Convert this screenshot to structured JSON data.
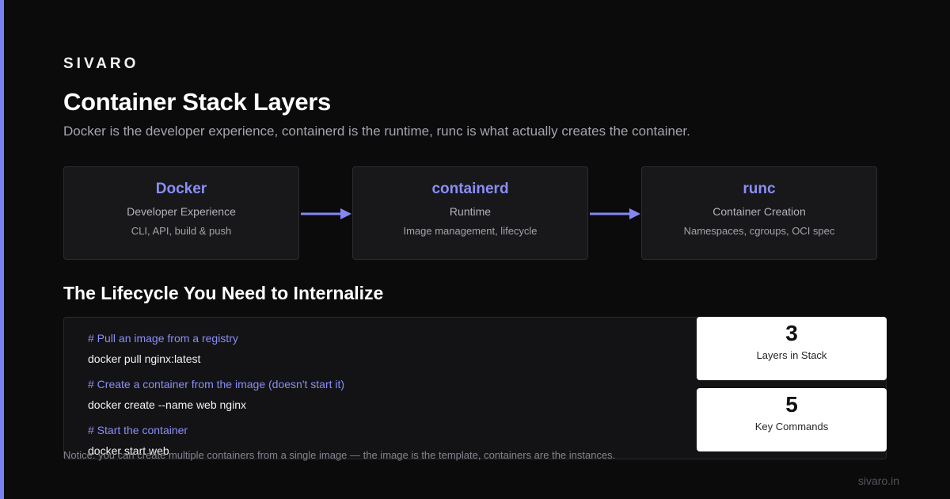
{
  "brand": "SIVARO",
  "title": "Container Stack Layers",
  "subtitle": "Docker is the developer experience, containerd is the runtime, runc is what actually creates the container.",
  "colors": {
    "accent": "#7c7ff0",
    "layer_name": "#8b8ef6",
    "background": "#0b0b0c"
  },
  "layers": [
    {
      "name": "Docker",
      "role": "Developer Experience",
      "detail": "CLI, API, build & push"
    },
    {
      "name": "containerd",
      "role": "Runtime",
      "detail": "Image management, lifecycle"
    },
    {
      "name": "runc",
      "role": "Container Creation",
      "detail": "Namespaces, cgroups, OCI spec"
    }
  ],
  "section_title": "The Lifecycle You Need to Internalize",
  "code": [
    {
      "comment": "# Pull an image from a registry",
      "command": "docker pull nginx:latest"
    },
    {
      "comment": "# Create a container from the image (doesn't start it)",
      "command": "docker create --name web nginx"
    },
    {
      "comment": "# Start the container",
      "command": "docker start web"
    }
  ],
  "stats": [
    {
      "value": "3",
      "label": "Layers in Stack"
    },
    {
      "value": "5",
      "label": "Key Commands"
    }
  ],
  "notice": "Notice: you can create multiple containers from a single image — the image is the template, containers are the instances.",
  "footer_url": "sivaro.in"
}
